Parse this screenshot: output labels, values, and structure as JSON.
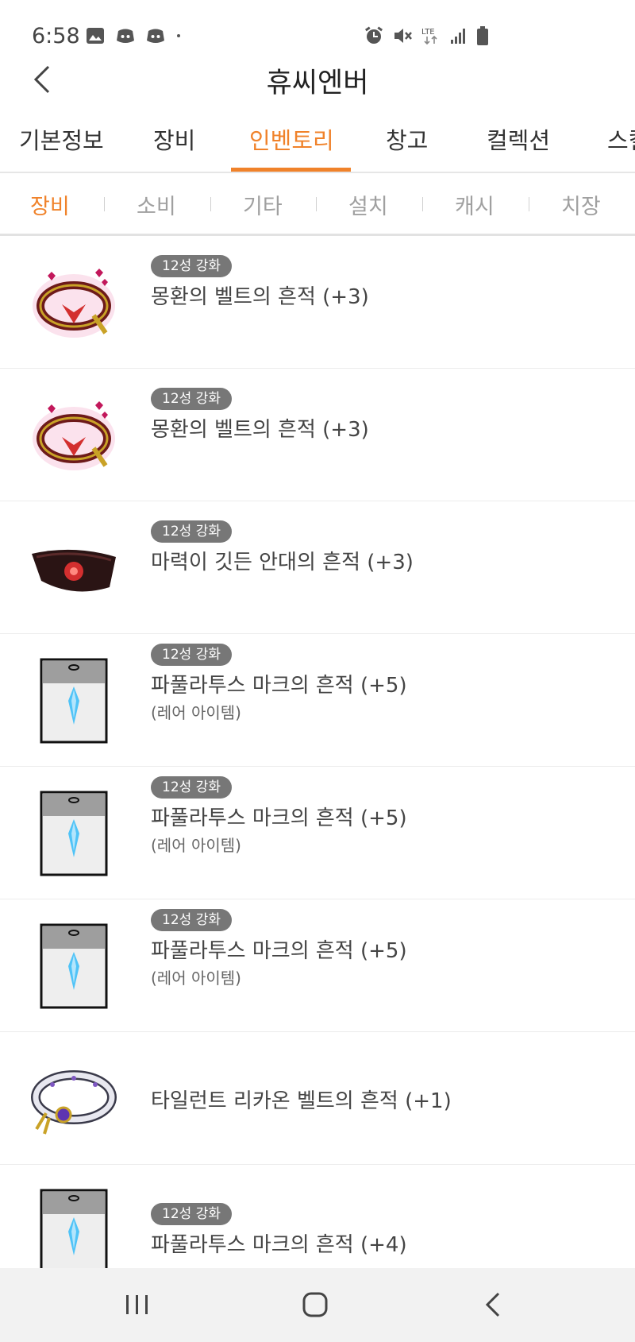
{
  "status": {
    "time": "6:58"
  },
  "header": {
    "title": "휴씨엔버"
  },
  "tabs": [
    {
      "label": "기본정보"
    },
    {
      "label": "장비"
    },
    {
      "label": "인벤토리"
    },
    {
      "label": "창고"
    },
    {
      "label": "컬렉션"
    },
    {
      "label": "스킬"
    }
  ],
  "active_tab": "인벤토리",
  "subtabs": [
    {
      "label": "장비"
    },
    {
      "label": "소비"
    },
    {
      "label": "기타"
    },
    {
      "label": "설치"
    },
    {
      "label": "캐시"
    },
    {
      "label": "치장"
    }
  ],
  "active_subtab": "장비",
  "items": [
    {
      "badge": "12성 강화",
      "name": "몽환의 벨트의 흔적 (+3)",
      "rarity": "",
      "icon": "dreamy-belt-icon"
    },
    {
      "badge": "12성 강화",
      "name": "몽환의 벨트의 흔적 (+3)",
      "rarity": "",
      "icon": "dreamy-belt-icon"
    },
    {
      "badge": "12성 강화",
      "name": "마력이 깃든 안대의 흔적 (+3)",
      "rarity": "",
      "icon": "magic-eyepatch-icon"
    },
    {
      "badge": "12성 강화",
      "name": "파풀라투스 마크의 흔적 (+5)",
      "rarity": "(레어 아이템)",
      "icon": "papulatus-mark-icon"
    },
    {
      "badge": "12성 강화",
      "name": "파풀라투스 마크의 흔적 (+5)",
      "rarity": "(레어 아이템)",
      "icon": "papulatus-mark-icon"
    },
    {
      "badge": "12성 강화",
      "name": "파풀라투스 마크의 흔적 (+5)",
      "rarity": "(레어 아이템)",
      "icon": "papulatus-mark-icon"
    },
    {
      "badge": "",
      "name": "타일런트 리카온 벨트의 흔적 (+1)",
      "rarity": "",
      "icon": "tyrant-lycaon-belt-icon"
    },
    {
      "badge": "12성 강화",
      "name": "파풀라투스 마크의 흔적 (+4)",
      "rarity": "",
      "icon": "papulatus-mark-icon"
    }
  ],
  "colors": {
    "accent": "#f0822a",
    "badge_bg": "#777777"
  }
}
